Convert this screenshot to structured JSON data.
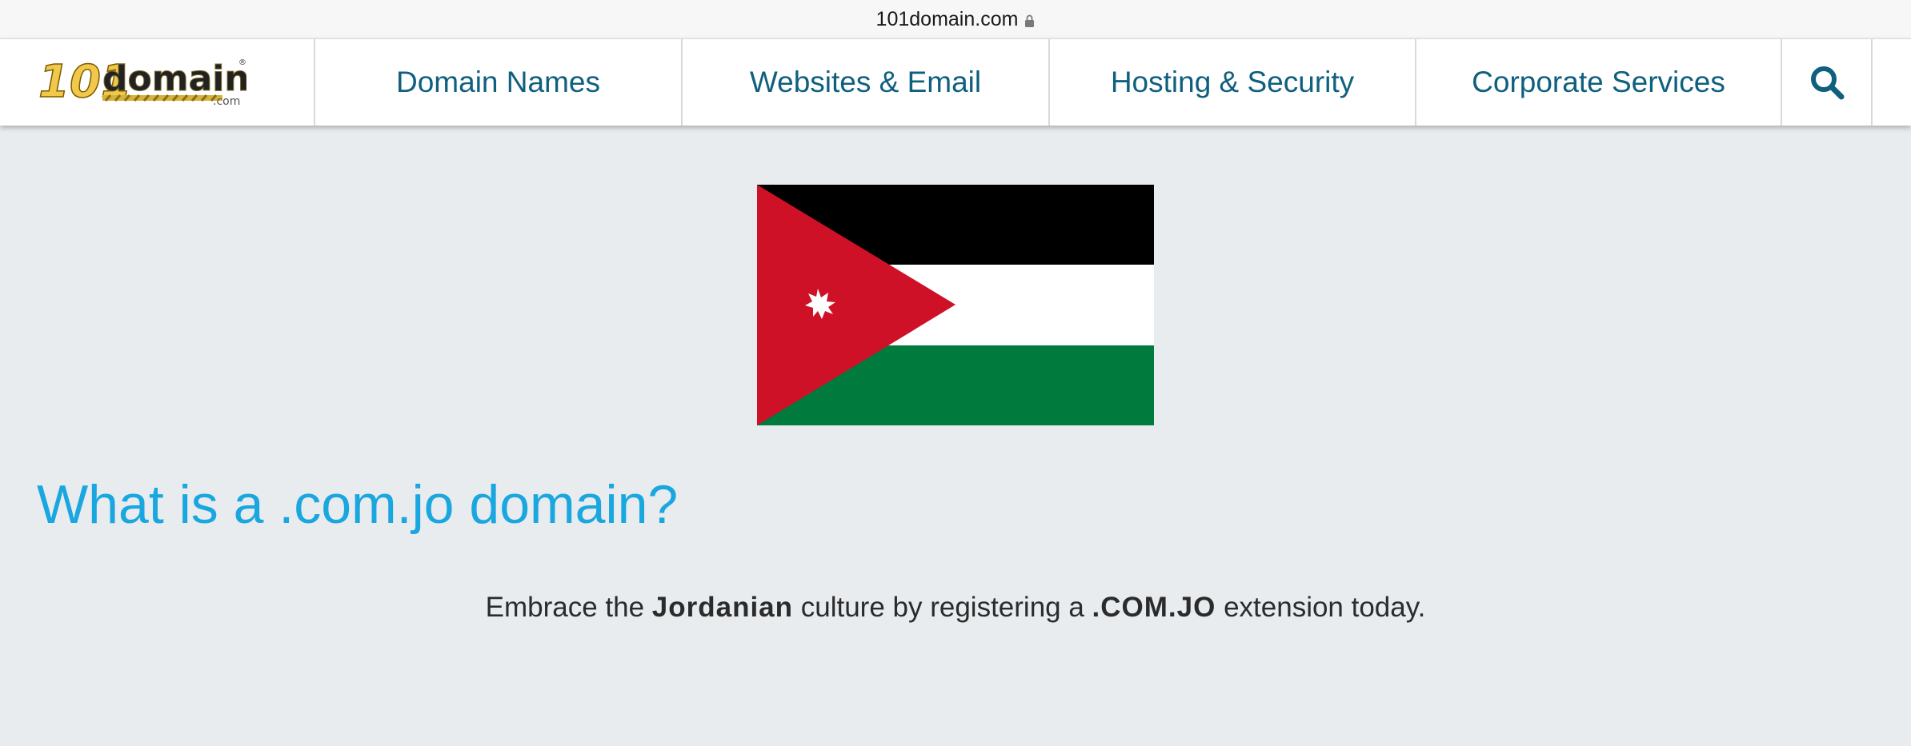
{
  "browser": {
    "url": "101domain.com"
  },
  "header": {
    "logo": {
      "number": "101",
      "word": "domain",
      "suffix": ".com",
      "registered": "®"
    },
    "nav": [
      {
        "label": "Domain Names"
      },
      {
        "label": "Websites & Email"
      },
      {
        "label": "Hosting & Security"
      },
      {
        "label": "Corporate Services"
      }
    ],
    "search_icon": "search-icon"
  },
  "hero": {
    "flag": "jordan-flag",
    "colors": {
      "black": "#000000",
      "white": "#ffffff",
      "green": "#007a3d",
      "red": "#ce1126"
    }
  },
  "main": {
    "heading": "What is a .com.jo domain?",
    "tagline": {
      "part1": "Embrace the ",
      "bold1": "Jordanian",
      "part2": " culture by registering a ",
      "bold2": ".COM.JO",
      "part3": " extension today."
    }
  },
  "theme": {
    "accent": "#1aa7e0",
    "nav_text": "#0f5f7f",
    "background": "#e8ecef"
  }
}
